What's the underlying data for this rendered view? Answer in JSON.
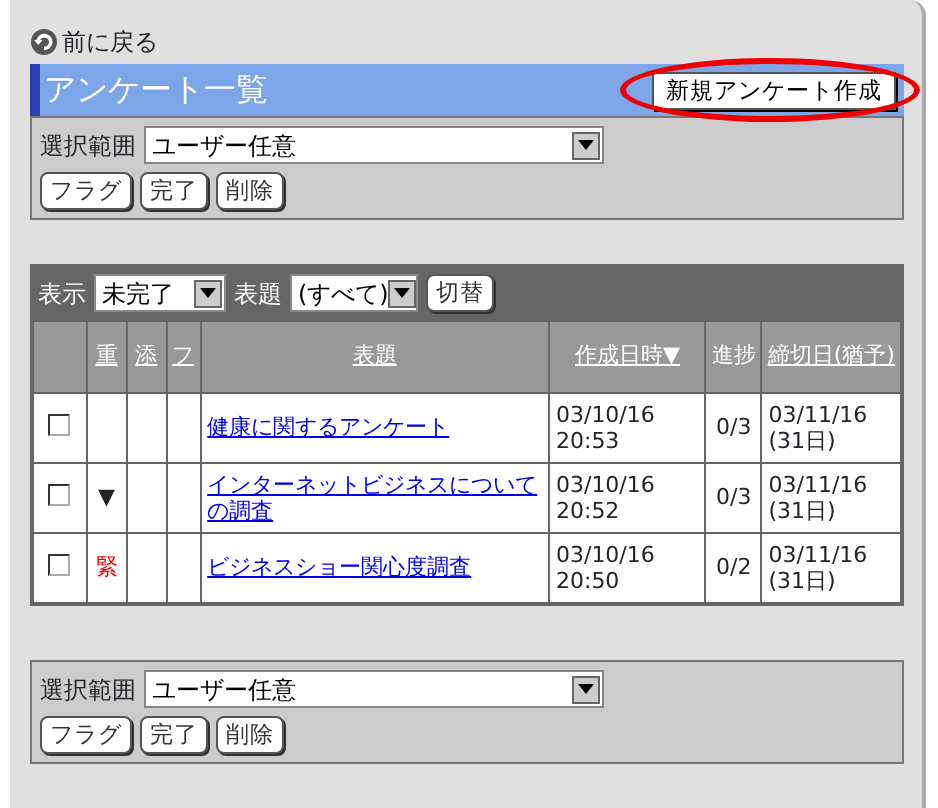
{
  "back_link": "前に戻る",
  "header": {
    "title": "アンケート一覧",
    "new_button": "新規アンケート作成",
    "highlighted": true
  },
  "top_actions": {
    "scope_label": "選択範囲",
    "scope_value": "ユーザー任意",
    "buttons": [
      "フラグ",
      "完了",
      "削除"
    ]
  },
  "filter": {
    "show_label": "表示",
    "show_value": "未完了",
    "title_label": "表題",
    "title_value": "(すべて)",
    "switch_button": "切替"
  },
  "table": {
    "columns": [
      {
        "label": "重",
        "link": true
      },
      {
        "label": "添",
        "link": true
      },
      {
        "label": "フ",
        "link": true
      },
      {
        "label": "表題",
        "link": true
      },
      {
        "label": "作成日時▼",
        "link": true
      },
      {
        "label": "進捗",
        "link": false
      },
      {
        "label": "締切日(猶予)",
        "link": true
      }
    ],
    "rows": [
      {
        "checked": false,
        "title": "健康に関するアンケート",
        "created": [
          "03/10/16",
          "20:53"
        ],
        "progress": "0/3",
        "deadline": [
          "03/11/16",
          "(31日)"
        ]
      },
      {
        "checked": false,
        "priority": {
          "kind": "arrow",
          "text": "▼"
        },
        "title": "インターネットビジネスについての調査",
        "created": [
          "03/10/16",
          "20:52"
        ],
        "progress": "0/3",
        "deadline": [
          "03/11/16",
          "(31日)"
        ]
      },
      {
        "checked": false,
        "priority": {
          "kind": "urgent",
          "text": "緊"
        },
        "title": "ビジネスショー関心度調査",
        "created": [
          "03/10/16",
          "20:50"
        ],
        "progress": "0/2",
        "deadline": [
          "03/11/16",
          "(31日)"
        ]
      }
    ]
  },
  "bottom_actions": {
    "scope_label": "選択範囲",
    "scope_value": "ユーザー任意",
    "buttons": [
      "フラグ",
      "完了",
      "削除"
    ]
  }
}
